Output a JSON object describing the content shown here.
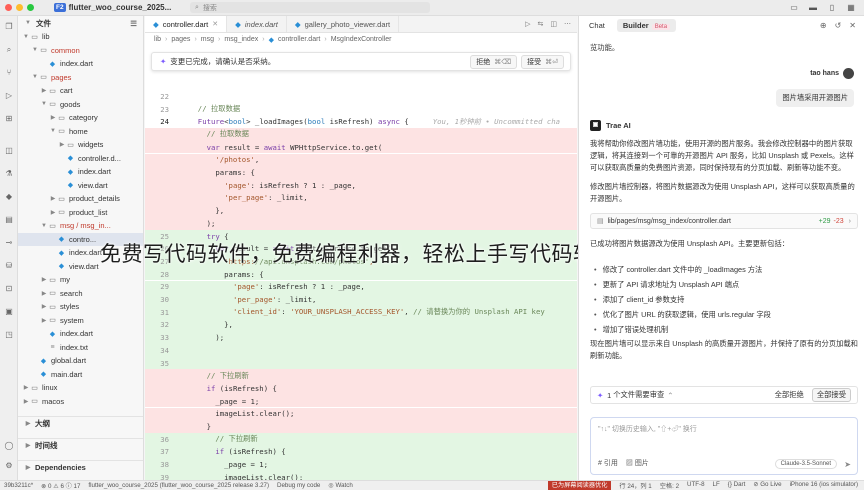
{
  "titlebar": {
    "project_badge": "F2",
    "project_name": "flutter_woo_course_2025...",
    "search_placeholder": "搜索"
  },
  "explorer": {
    "title": "文件",
    "items": [
      {
        "label": "lib",
        "kind": "folder",
        "open": true,
        "depth": 0
      },
      {
        "label": "common",
        "kind": "folder",
        "open": true,
        "depth": 1,
        "modified": true
      },
      {
        "label": "index.dart",
        "kind": "dart",
        "depth": 2
      },
      {
        "label": "pages",
        "kind": "folder",
        "open": true,
        "depth": 1,
        "modified": true
      },
      {
        "label": "cart",
        "kind": "folder",
        "open": false,
        "depth": 2
      },
      {
        "label": "goods",
        "kind": "folder",
        "open": true,
        "depth": 2
      },
      {
        "label": "category",
        "kind": "folder",
        "open": false,
        "depth": 3
      },
      {
        "label": "home",
        "kind": "folder",
        "open": true,
        "depth": 3
      },
      {
        "label": "widgets",
        "kind": "folder",
        "open": false,
        "depth": 4
      },
      {
        "label": "controller.d...",
        "kind": "dart",
        "depth": 4
      },
      {
        "label": "index.dart",
        "kind": "dart",
        "depth": 4
      },
      {
        "label": "view.dart",
        "kind": "dart",
        "depth": 4
      },
      {
        "label": "product_details",
        "kind": "folder",
        "open": false,
        "depth": 3
      },
      {
        "label": "product_list",
        "kind": "folder",
        "open": false,
        "depth": 3
      },
      {
        "label": "msg / msg_in...",
        "kind": "folder",
        "open": true,
        "depth": 2,
        "modified": true
      },
      {
        "label": "contro...",
        "kind": "dart",
        "depth": 3,
        "selected": true
      },
      {
        "label": "index.dart",
        "kind": "dart",
        "depth": 3
      },
      {
        "label": "view.dart",
        "kind": "dart",
        "depth": 3
      },
      {
        "label": "my",
        "kind": "folder",
        "open": false,
        "depth": 2
      },
      {
        "label": "search",
        "kind": "folder",
        "open": false,
        "depth": 2
      },
      {
        "label": "styles",
        "kind": "folder",
        "open": false,
        "depth": 2
      },
      {
        "label": "system",
        "kind": "folder",
        "open": false,
        "depth": 2
      },
      {
        "label": "index.dart",
        "kind": "dart",
        "depth": 2
      },
      {
        "label": "index.txt",
        "kind": "txt",
        "depth": 2
      },
      {
        "label": "global.dart",
        "kind": "dart",
        "depth": 1
      },
      {
        "label": "main.dart",
        "kind": "dart",
        "depth": 1
      },
      {
        "label": "linux",
        "kind": "folder",
        "open": false,
        "depth": 0
      },
      {
        "label": "macos",
        "kind": "folder",
        "open": false,
        "depth": 0
      }
    ],
    "sections": [
      "大纲",
      "时间线",
      "Dependencies"
    ]
  },
  "editor": {
    "tabs": [
      {
        "label": "controller.dart",
        "active": true
      },
      {
        "label": "index.dart",
        "active": false,
        "italic": true
      },
      {
        "label": "gallery_photo_viewer.dart",
        "active": false
      }
    ],
    "breadcrumb": [
      "lib",
      "pages",
      "msg",
      "msg_index",
      "controller.dart",
      "MsgIndexController"
    ],
    "review": {
      "message": "变更已完成，请确认是否采纳。",
      "reject": "拒绝",
      "reject_key": "⌘⌫",
      "accept": "接受",
      "accept_key": "⌘⏎"
    },
    "code_lines": [
      {
        "n": "22",
        "text": "",
        "kind": "plain"
      },
      {
        "n": "23",
        "text": "  // 拉取数据",
        "kind": "plain"
      },
      {
        "n": "24",
        "text": "  Future<bool> _loadImages(bool isRefresh) async {",
        "kind": "plain",
        "current": true,
        "ghost": "You, 1秒钟前 • Uncommitted cha"
      },
      {
        "n": "",
        "text": "    // 拉取数据",
        "kind": "del"
      },
      {
        "n": "",
        "text": "    var result = await WPHttpService.to.get(",
        "kind": "del"
      },
      {
        "n": "",
        "text": "      '/photos',",
        "kind": "del"
      },
      {
        "n": "",
        "text": "      params: {",
        "kind": "del"
      },
      {
        "n": "",
        "text": "        'page': isRefresh ? 1 : _page,",
        "kind": "del"
      },
      {
        "n": "",
        "text": "        'per_page': _limit,",
        "kind": "del"
      },
      {
        "n": "",
        "text": "      },",
        "kind": "del"
      },
      {
        "n": "",
        "text": "    );",
        "kind": "del"
      },
      {
        "n": "25",
        "text": "    try {",
        "kind": "add"
      },
      {
        "n": "26",
        "text": "      var result = await WPHttpService.to.get(",
        "kind": "add"
      },
      {
        "n": "27",
        "text": "        'https://api.unsplash.com/photos',",
        "kind": "add"
      },
      {
        "n": "28",
        "text": "        params: {",
        "kind": "add"
      },
      {
        "n": "29",
        "text": "          'page': isRefresh ? 1 : _page,",
        "kind": "add"
      },
      {
        "n": "30",
        "text": "          'per_page': _limit,",
        "kind": "add"
      },
      {
        "n": "31",
        "text": "          'client_id': 'YOUR_UNSPLASH_ACCESS_KEY', // 请替换为你的 Unsplash API key",
        "kind": "add"
      },
      {
        "n": "32",
        "text": "        },",
        "kind": "add"
      },
      {
        "n": "33",
        "text": "      );",
        "kind": "add"
      },
      {
        "n": "34",
        "text": "",
        "kind": "add"
      },
      {
        "n": "35",
        "text": "",
        "kind": "add"
      },
      {
        "n": "",
        "text": "    // 下拉刷新",
        "kind": "del"
      },
      {
        "n": "",
        "text": "    if (isRefresh) {",
        "kind": "del"
      },
      {
        "n": "",
        "text": "      _page = 1;",
        "kind": "del"
      },
      {
        "n": "",
        "text": "      imageList.clear();",
        "kind": "del"
      },
      {
        "n": "",
        "text": "    }",
        "kind": "del"
      },
      {
        "n": "36",
        "text": "      // 下拉刷新",
        "kind": "add"
      },
      {
        "n": "37",
        "text": "      if (isRefresh) {",
        "kind": "add"
      },
      {
        "n": "38",
        "text": "        _page = 1;",
        "kind": "add"
      },
      {
        "n": "39",
        "text": "        imageList.clear();",
        "kind": "add"
      }
    ]
  },
  "overlay_caption": "免费写代码软件，免费编程利器，轻松上手写代码软件推荐",
  "chat": {
    "tabs": {
      "chat": "Chat",
      "builder": "Builder",
      "beta": "Beta"
    },
    "top_text": "览功能。",
    "user_name": "tao hans",
    "user_message": "图片墙采用开源图片",
    "ai_name": "Trae AI",
    "ai_para1": "我将帮助你修改图片墙功能，使用开源的图片服务。我会修改控制器中的图片获取逻辑，将其连接到一个可靠的开源图片 API 服务，比如 Unsplash 或 Pexels。这样可以获取高质量的免费图片资源，同时保持现有的分页加载、刷新等功能不变。",
    "ai_para2": "修改图片墙控制器，将图片数据源改为使用 Unsplash API，这样可以获取高质量的开源图片。",
    "file_card": {
      "path": "lib/pages/msg/msg_index/controller.dart",
      "added": "+29",
      "removed": "-23"
    },
    "ai_para3": "已成功将图片数据源改为使用 Unsplash API。主要更新包括：",
    "bullets": [
      "修改了 controller.dart 文件中的 _loadImages 方法",
      "更新了 API 请求地址为 Unsplash API 端点",
      "添加了 client_id 参数支持",
      "优化了图片 URL 的获取逻辑，使用 urls.regular 字段",
      "增加了错误处理机制"
    ],
    "ai_para4": "现在图片墙可以显示来自 Unsplash 的高质量开源图片，并保持了原有的分页加载和刷新功能。",
    "review": {
      "count": "1",
      "label": "个文件需要审查",
      "reject_all": "全部拒绝",
      "accept_all": "全部接受"
    },
    "input_placeholder": "\"↑↓\" 切换历史输入, \"⇧+⏎\" 换行",
    "input_ref": "引用",
    "input_image": "图片",
    "model": "Claude-3.5-Sonnet"
  },
  "statusbar": {
    "left": [
      "39b3211c*",
      "⊗ 0 ⚠ 6 ⓘ 17",
      "flutter_woo_course_2025 (flutter_woo_course_2025 release 3.27)",
      "Debug my code",
      "◎ Watch"
    ],
    "highlight": "已为屏幕阅读器优化",
    "right": [
      "行 24，列 1",
      "空格: 2",
      "UTF-8",
      "LF",
      "{} Dart",
      "⊘ Go Live",
      "iPhone 16 (ios simulator)"
    ]
  }
}
